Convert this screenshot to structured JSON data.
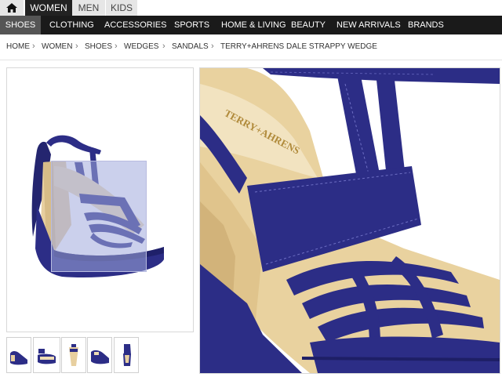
{
  "gender_tabs": [
    "WOMEN",
    "MEN",
    "KIDS"
  ],
  "nav": [
    "SHOES",
    "CLOTHING",
    "ACCESSORIES",
    "SPORTS",
    "HOME & LIVING",
    "BEAUTY",
    "NEW ARRIVALS",
    "BRANDS"
  ],
  "breadcrumb": [
    "HOME",
    "WOMEN",
    "SHOES",
    "WEDGES",
    "SANDALS",
    "TERRY+AHRENS DALE STRAPPY WEDGE"
  ],
  "breadcrumb_separator": "›",
  "product": {
    "brand_logo_text": "TERRY+AHRENS"
  },
  "thumbnails_count": 5,
  "icons": {
    "home": "home-icon",
    "chevron": "chevron-right-icon"
  },
  "colors": {
    "nav_bg": "#1a1a1a",
    "active_nav": "#555555",
    "shoe": "#2c2d86",
    "sole": "#e7cf9f"
  }
}
